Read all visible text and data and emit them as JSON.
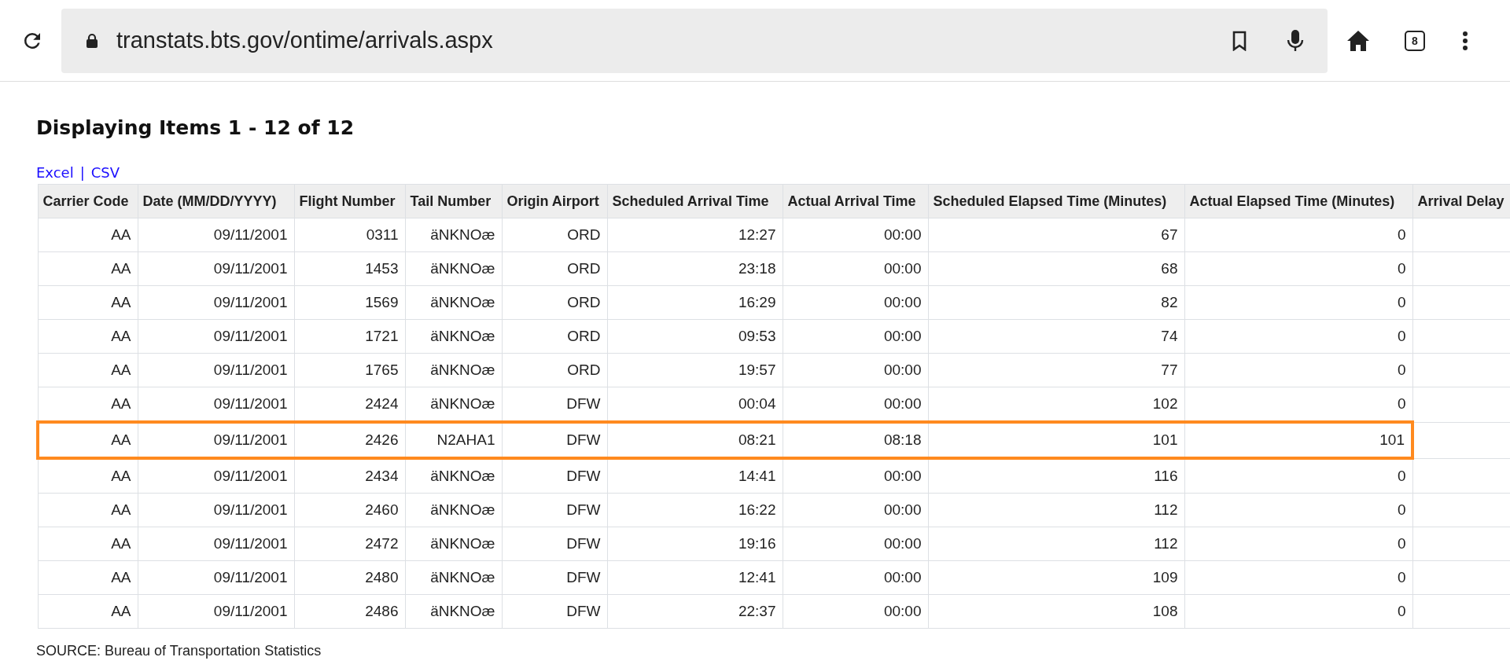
{
  "browser": {
    "url": "transtats.bts.gov/ontime/arrivals.aspx",
    "tab_count": "8"
  },
  "title": "Displaying Items 1 - 12 of 12",
  "export_links": [
    "Excel",
    "CSV"
  ],
  "export_separator": "|",
  "table": {
    "columns": [
      "Carrier Code",
      "Date (MM/DD/YYYY)",
      "Flight Number",
      "Tail Number",
      "Origin Airport",
      "Scheduled Arrival Time",
      "Actual Arrival Time",
      "Scheduled Elapsed Time (Minutes)",
      "Actual Elapsed Time (Minutes)",
      "Arrival Delay"
    ],
    "rows": [
      {
        "cells": [
          "AA",
          "09/11/2001",
          "0311",
          "äNKNOæ",
          "ORD",
          "12:27",
          "00:00",
          "67",
          "0"
        ],
        "highlighted": false
      },
      {
        "cells": [
          "AA",
          "09/11/2001",
          "1453",
          "äNKNOæ",
          "ORD",
          "23:18",
          "00:00",
          "68",
          "0"
        ],
        "highlighted": false
      },
      {
        "cells": [
          "AA",
          "09/11/2001",
          "1569",
          "äNKNOæ",
          "ORD",
          "16:29",
          "00:00",
          "82",
          "0"
        ],
        "highlighted": false
      },
      {
        "cells": [
          "AA",
          "09/11/2001",
          "1721",
          "äNKNOæ",
          "ORD",
          "09:53",
          "00:00",
          "74",
          "0"
        ],
        "highlighted": false
      },
      {
        "cells": [
          "AA",
          "09/11/2001",
          "1765",
          "äNKNOæ",
          "ORD",
          "19:57",
          "00:00",
          "77",
          "0"
        ],
        "highlighted": false
      },
      {
        "cells": [
          "AA",
          "09/11/2001",
          "2424",
          "äNKNOæ",
          "DFW",
          "00:04",
          "00:00",
          "102",
          "0"
        ],
        "highlighted": false
      },
      {
        "cells": [
          "AA",
          "09/11/2001",
          "2426",
          "N2AHA1",
          "DFW",
          "08:21",
          "08:18",
          "101",
          "101"
        ],
        "highlighted": true
      },
      {
        "cells": [
          "AA",
          "09/11/2001",
          "2434",
          "äNKNOæ",
          "DFW",
          "14:41",
          "00:00",
          "116",
          "0"
        ],
        "highlighted": false
      },
      {
        "cells": [
          "AA",
          "09/11/2001",
          "2460",
          "äNKNOæ",
          "DFW",
          "16:22",
          "00:00",
          "112",
          "0"
        ],
        "highlighted": false
      },
      {
        "cells": [
          "AA",
          "09/11/2001",
          "2472",
          "äNKNOæ",
          "DFW",
          "19:16",
          "00:00",
          "112",
          "0"
        ],
        "highlighted": false
      },
      {
        "cells": [
          "AA",
          "09/11/2001",
          "2480",
          "äNKNOæ",
          "DFW",
          "12:41",
          "00:00",
          "109",
          "0"
        ],
        "highlighted": false
      },
      {
        "cells": [
          "AA",
          "09/11/2001",
          "2486",
          "äNKNOæ",
          "DFW",
          "22:37",
          "00:00",
          "108",
          "0"
        ],
        "highlighted": false
      }
    ]
  },
  "source": "SOURCE: Bureau of Transportation Statistics"
}
